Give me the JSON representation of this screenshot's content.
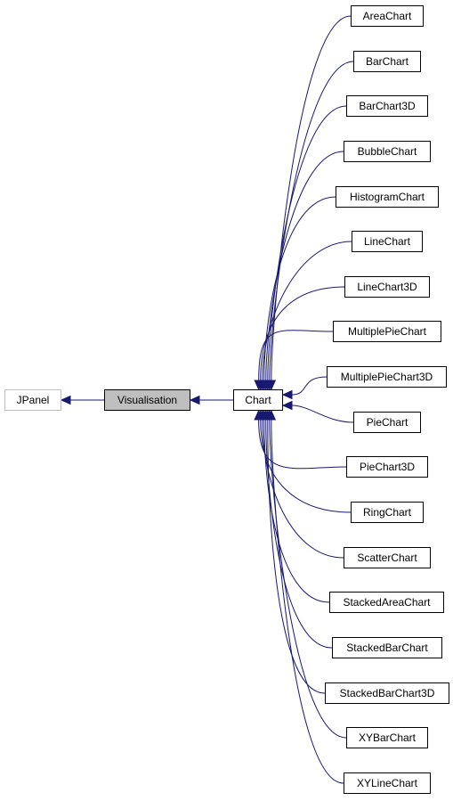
{
  "diagram": {
    "type": "class-inheritance-graph",
    "edge_color": "#191970",
    "nodes": [
      {
        "id": "JPanel",
        "label": "JPanel",
        "style": "external"
      },
      {
        "id": "Visualisation",
        "label": "Visualisation",
        "style": "current"
      },
      {
        "id": "Chart",
        "label": "Chart",
        "style": "normal"
      },
      {
        "id": "AreaChart",
        "label": "AreaChart",
        "style": "normal"
      },
      {
        "id": "BarChart",
        "label": "BarChart",
        "style": "normal"
      },
      {
        "id": "BarChart3D",
        "label": "BarChart3D",
        "style": "normal"
      },
      {
        "id": "BubbleChart",
        "label": "BubbleChart",
        "style": "normal"
      },
      {
        "id": "HistogramChart",
        "label": "HistogramChart",
        "style": "normal"
      },
      {
        "id": "LineChart",
        "label": "LineChart",
        "style": "normal"
      },
      {
        "id": "LineChart3D",
        "label": "LineChart3D",
        "style": "normal"
      },
      {
        "id": "MultiplePieChart",
        "label": "MultiplePieChart",
        "style": "normal"
      },
      {
        "id": "MultiplePieChart3D",
        "label": "MultiplePieChart3D",
        "style": "normal"
      },
      {
        "id": "PieChart",
        "label": "PieChart",
        "style": "normal"
      },
      {
        "id": "PieChart3D",
        "label": "PieChart3D",
        "style": "normal"
      },
      {
        "id": "RingChart",
        "label": "RingChart",
        "style": "normal"
      },
      {
        "id": "ScatterChart",
        "label": "ScatterChart",
        "style": "normal"
      },
      {
        "id": "StackedAreaChart",
        "label": "StackedAreaChart",
        "style": "normal"
      },
      {
        "id": "StackedBarChart",
        "label": "StackedBarChart",
        "style": "normal"
      },
      {
        "id": "StackedBarChart3D",
        "label": "StackedBarChart3D",
        "style": "normal"
      },
      {
        "id": "XYBarChart",
        "label": "XYBarChart",
        "style": "normal"
      },
      {
        "id": "XYLineChart",
        "label": "XYLineChart",
        "style": "normal"
      }
    ],
    "edges": [
      {
        "from": "Visualisation",
        "to": "JPanel"
      },
      {
        "from": "Chart",
        "to": "Visualisation"
      },
      {
        "from": "AreaChart",
        "to": "Chart"
      },
      {
        "from": "BarChart",
        "to": "Chart"
      },
      {
        "from": "BarChart3D",
        "to": "Chart"
      },
      {
        "from": "BubbleChart",
        "to": "Chart"
      },
      {
        "from": "HistogramChart",
        "to": "Chart"
      },
      {
        "from": "LineChart",
        "to": "Chart"
      },
      {
        "from": "LineChart3D",
        "to": "Chart"
      },
      {
        "from": "MultiplePieChart",
        "to": "Chart"
      },
      {
        "from": "MultiplePieChart3D",
        "to": "Chart"
      },
      {
        "from": "PieChart",
        "to": "Chart"
      },
      {
        "from": "PieChart3D",
        "to": "Chart"
      },
      {
        "from": "RingChart",
        "to": "Chart"
      },
      {
        "from": "ScatterChart",
        "to": "Chart"
      },
      {
        "from": "StackedAreaChart",
        "to": "Chart"
      },
      {
        "from": "StackedBarChart",
        "to": "Chart"
      },
      {
        "from": "StackedBarChart3D",
        "to": "Chart"
      },
      {
        "from": "XYBarChart",
        "to": "Chart"
      },
      {
        "from": "XYLineChart",
        "to": "Chart"
      }
    ]
  }
}
